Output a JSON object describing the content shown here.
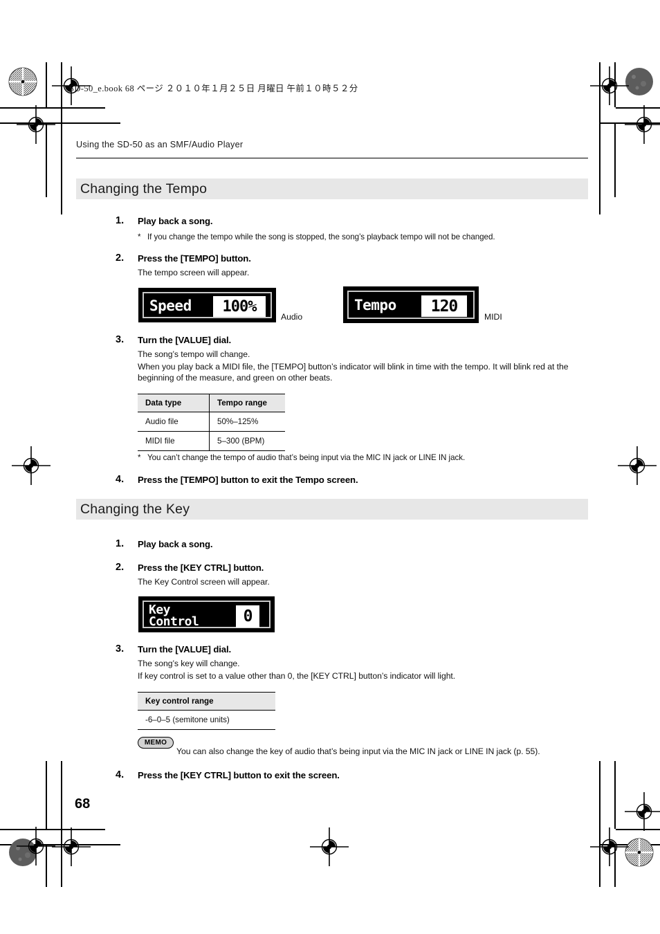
{
  "page": {
    "folio": "68",
    "book_info": "SD-50_e.book   68 ページ   ２０１０年１月２５日   月曜日   午前１０時５２分",
    "running_header": "Using the SD-50 as an SMF/Audio Player"
  },
  "sections": [
    {
      "title": "Changing the Tempo",
      "steps": [
        {
          "num": "1.",
          "heading": "Play back a song.",
          "note": "If you change the tempo while the song is stopped, the song’s playback tempo will not be changed."
        },
        {
          "num": "2.",
          "heading": "Press the [TEMPO] button.",
          "body": "The tempo screen will appear."
        },
        {
          "num": "3.",
          "heading": "Turn the [VALUE] dial.",
          "body1": "The song’s tempo will change.",
          "body2": "When you play back a MIDI file, the [TEMPO] button’s indicator will blink in time with the tempo. It will blink red at the beginning of the measure, and green on other beats.",
          "note": "You can’t change the tempo of audio that’s being input via the MIC IN jack or LINE IN jack."
        },
        {
          "num": "4.",
          "heading": "Press the [TEMPO] button to exit the Tempo screen."
        }
      ],
      "displays": [
        {
          "label": "Speed",
          "value": "100%",
          "caption": "Audio"
        },
        {
          "label": "Tempo",
          "value": "120",
          "caption": "MIDI"
        }
      ],
      "table": {
        "headers": [
          "Data type",
          "Tempo range"
        ],
        "rows": [
          [
            "Audio file",
            "50%–125%"
          ],
          [
            "MIDI file",
            "5–300 (BPM)"
          ]
        ]
      }
    },
    {
      "title": "Changing the Key",
      "steps": [
        {
          "num": "1.",
          "heading": "Play back a song."
        },
        {
          "num": "2.",
          "heading": "Press the [KEY CTRL] button.",
          "body": "The Key Control screen will appear."
        },
        {
          "num": "3.",
          "heading": "Turn the [VALUE] dial.",
          "body1": "The song’s key will change.",
          "body2": "If key control is set to a value other than 0, the [KEY CTRL] button’s indicator will light."
        },
        {
          "num": "4.",
          "heading": "Press the [KEY CTRL] button to exit the screen."
        }
      ],
      "display": {
        "line1": "Key",
        "line2": "Control",
        "value": "0"
      },
      "table": {
        "header": "Key control range",
        "row": "-6–0–5 (semitone units)"
      },
      "memo": {
        "badge": "MEMO",
        "text": "You can also change the key of audio that’s being input via the MIC IN jack or LINE IN jack (p. 55)."
      }
    }
  ],
  "colors": {
    "section_bar_bg": "#e7e7e7",
    "table_header_bg": "#e7e7e7",
    "lcd_bg": "#000000",
    "lcd_fg": "#ffffff",
    "text": "#111111"
  }
}
